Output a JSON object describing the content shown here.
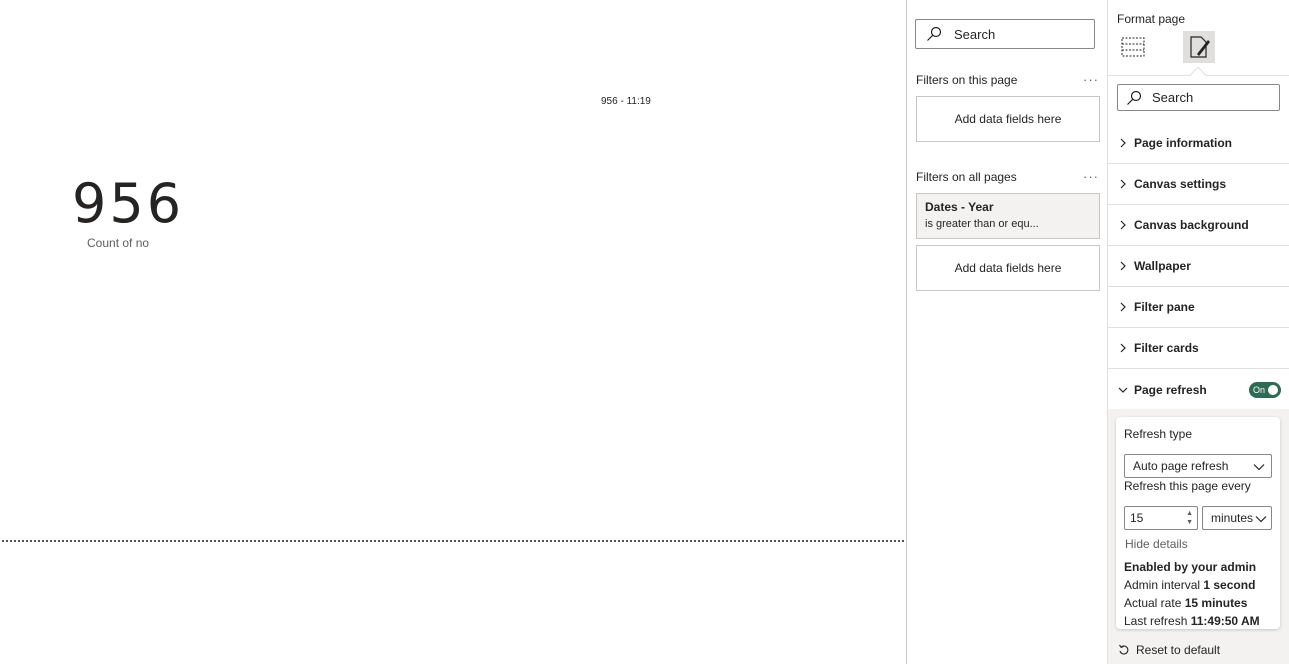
{
  "canvas": {
    "card_title": "956 - 11:19",
    "kpi_value": "956",
    "kpi_label": "Count of no"
  },
  "filters": {
    "search_placeholder": "Search",
    "this_page_label": "Filters on this page",
    "all_pages_label": "Filters on all pages",
    "more_glyph": "···",
    "add_fields_label": "Add data fields here",
    "filter_card": {
      "title": "Dates - Year",
      "summary": "is greater than or equ..."
    }
  },
  "format": {
    "title": "Format page",
    "search_placeholder": "Search",
    "sections": [
      {
        "label": "Page information"
      },
      {
        "label": "Canvas settings"
      },
      {
        "label": "Canvas background"
      },
      {
        "label": "Wallpaper"
      },
      {
        "label": "Filter pane"
      },
      {
        "label": "Filter cards"
      }
    ],
    "page_refresh": {
      "label": "Page refresh",
      "toggle_label": "On",
      "refresh_type_label": "Refresh type",
      "refresh_type_value": "Auto page refresh",
      "interval_label": "Refresh this page every",
      "interval_value": "15",
      "interval_unit": "minutes",
      "hide_details": "Hide details",
      "enabled_by": "Enabled by your admin",
      "admin_interval_label": "Admin interval",
      "admin_interval_value": "1 second",
      "actual_rate_label": "Actual rate",
      "actual_rate_value": "15 minutes",
      "last_refresh_label": "Last refresh",
      "last_refresh_value": "11:49:50 AM"
    },
    "reset_label": "Reset to default"
  },
  "colors": {
    "toggle_on": "#2e6b55",
    "panel_bg": "#f3f2f1"
  },
  "icons": [
    "search-icon",
    "more-options-icon",
    "chevron-right-icon",
    "chevron-down-icon",
    "visual-format-icon",
    "page-format-icon",
    "reset-icon"
  ]
}
